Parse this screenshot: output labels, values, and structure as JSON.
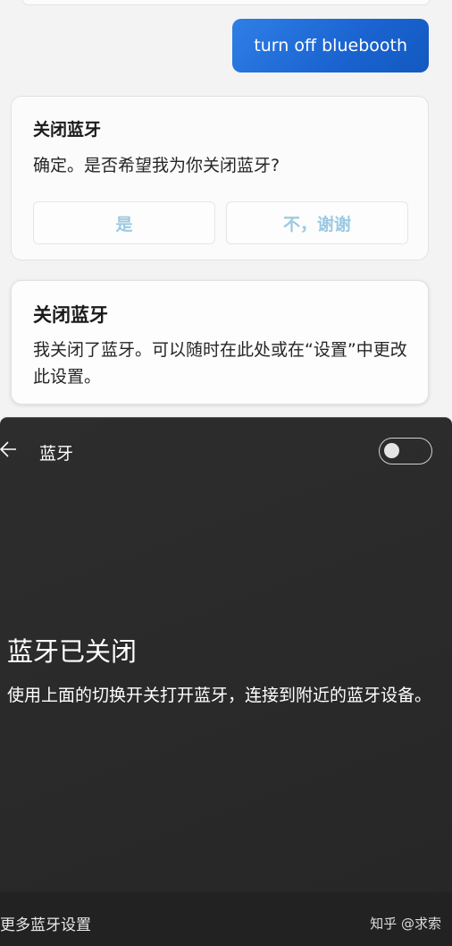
{
  "chat": {
    "user_message": "turn off bluebooth",
    "card1": {
      "title": "关闭蓝牙",
      "text": "确定。是否希望我为你关闭蓝牙?",
      "yes_label": "是",
      "no_label": "不，谢谢"
    },
    "card2": {
      "title": "关闭蓝牙",
      "text": "我关闭了蓝牙。可以随时在此处或在“设置”中更改此设置。"
    }
  },
  "bluetooth_panel": {
    "back_icon": "arrow-left-icon",
    "title": "蓝牙",
    "toggle_state": "off",
    "status_title": "蓝牙已关闭",
    "status_desc": "使用上面的切换开关打开蓝牙，连接到附近的蓝牙设备。",
    "more_settings_label": "更多蓝牙设置"
  },
  "watermark": "知乎 @求索",
  "colors": {
    "user_bubble": "#1f6bd8",
    "button_text": "#9cc9e3",
    "panel_bg": "#2b2b2b"
  }
}
